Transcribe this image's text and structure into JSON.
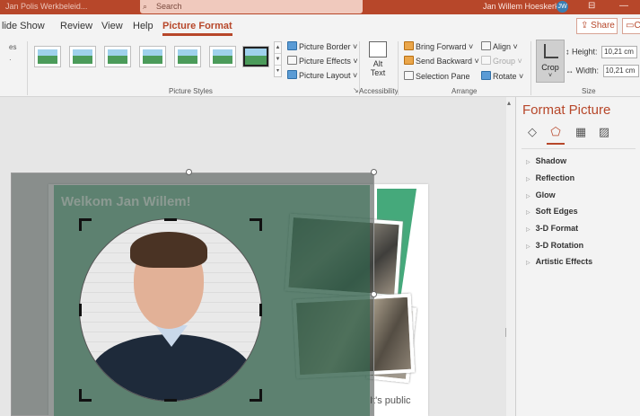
{
  "titlebar": {
    "doc_title": "Jan Polis Werkbeleid...",
    "search_placeholder": "Search",
    "user_name": "Jan Willem Hoeskerk",
    "avatar_initials": "JW"
  },
  "tabs": [
    {
      "label": "lide Show"
    },
    {
      "label": "Review"
    },
    {
      "label": "View"
    },
    {
      "label": "Help"
    },
    {
      "label": "Picture Format",
      "active": true
    }
  ],
  "share_label": "Share",
  "comments_label": "C",
  "ribbon": {
    "styles_left_label": "es",
    "picture_styles_label": "Picture Styles",
    "picture_border": "Picture Border",
    "picture_effects": "Picture Effects",
    "picture_layout": "Picture Layout",
    "alt_text_line1": "Alt",
    "alt_text_line2": "Text",
    "accessibility_label": "Accessibility",
    "bring_forward": "Bring Forward",
    "send_backward": "Send Backward",
    "selection_pane": "Selection Pane",
    "align": "Align",
    "group": "Group",
    "rotate": "Rotate",
    "arrange_label": "Arrange",
    "crop_label": "Crop",
    "height_label": "Height:",
    "height_value": "10,21 cm",
    "width_label": "Width:",
    "width_value": "10,21 cm",
    "size_label": "Size"
  },
  "slide": {
    "welcome_text": "Welkom Jan Willem!",
    "public_text": "It's public"
  },
  "pane": {
    "title": "Format Picture",
    "items": [
      "Shadow",
      "Reflection",
      "Glow",
      "Soft Edges",
      "3-D Format",
      "3-D Rotation",
      "Artistic Effects"
    ]
  },
  "icons": {
    "fill": "paint-bucket-icon",
    "effects": "pentagon-icon",
    "size": "size-properties-icon",
    "picture": "picture-icon"
  },
  "colors": {
    "accent": "#b7472a",
    "ribbon_bg": "#f3f3f3",
    "slide_green": "#45a97b"
  }
}
